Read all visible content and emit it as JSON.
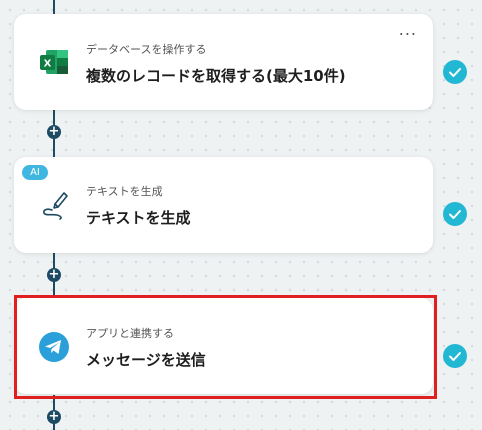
{
  "steps": [
    {
      "category": "データベースを操作する",
      "title": "複数のレコードを取得する(最大10件)",
      "icon": "excel-icon",
      "status": "completed"
    },
    {
      "badge": "AI",
      "category": "テキストを生成",
      "title": "テキストを生成",
      "icon": "pen-icon",
      "status": "completed"
    },
    {
      "category": "アプリと連携する",
      "title": "メッセージを送信",
      "icon": "telegram-icon",
      "status": "completed"
    }
  ],
  "more_label": "...",
  "add_label": "+",
  "colors": {
    "accent": "#22b8d4",
    "connector": "#1c4b63",
    "highlight": "#e02020",
    "ai_badge": "#3fb7e0"
  }
}
